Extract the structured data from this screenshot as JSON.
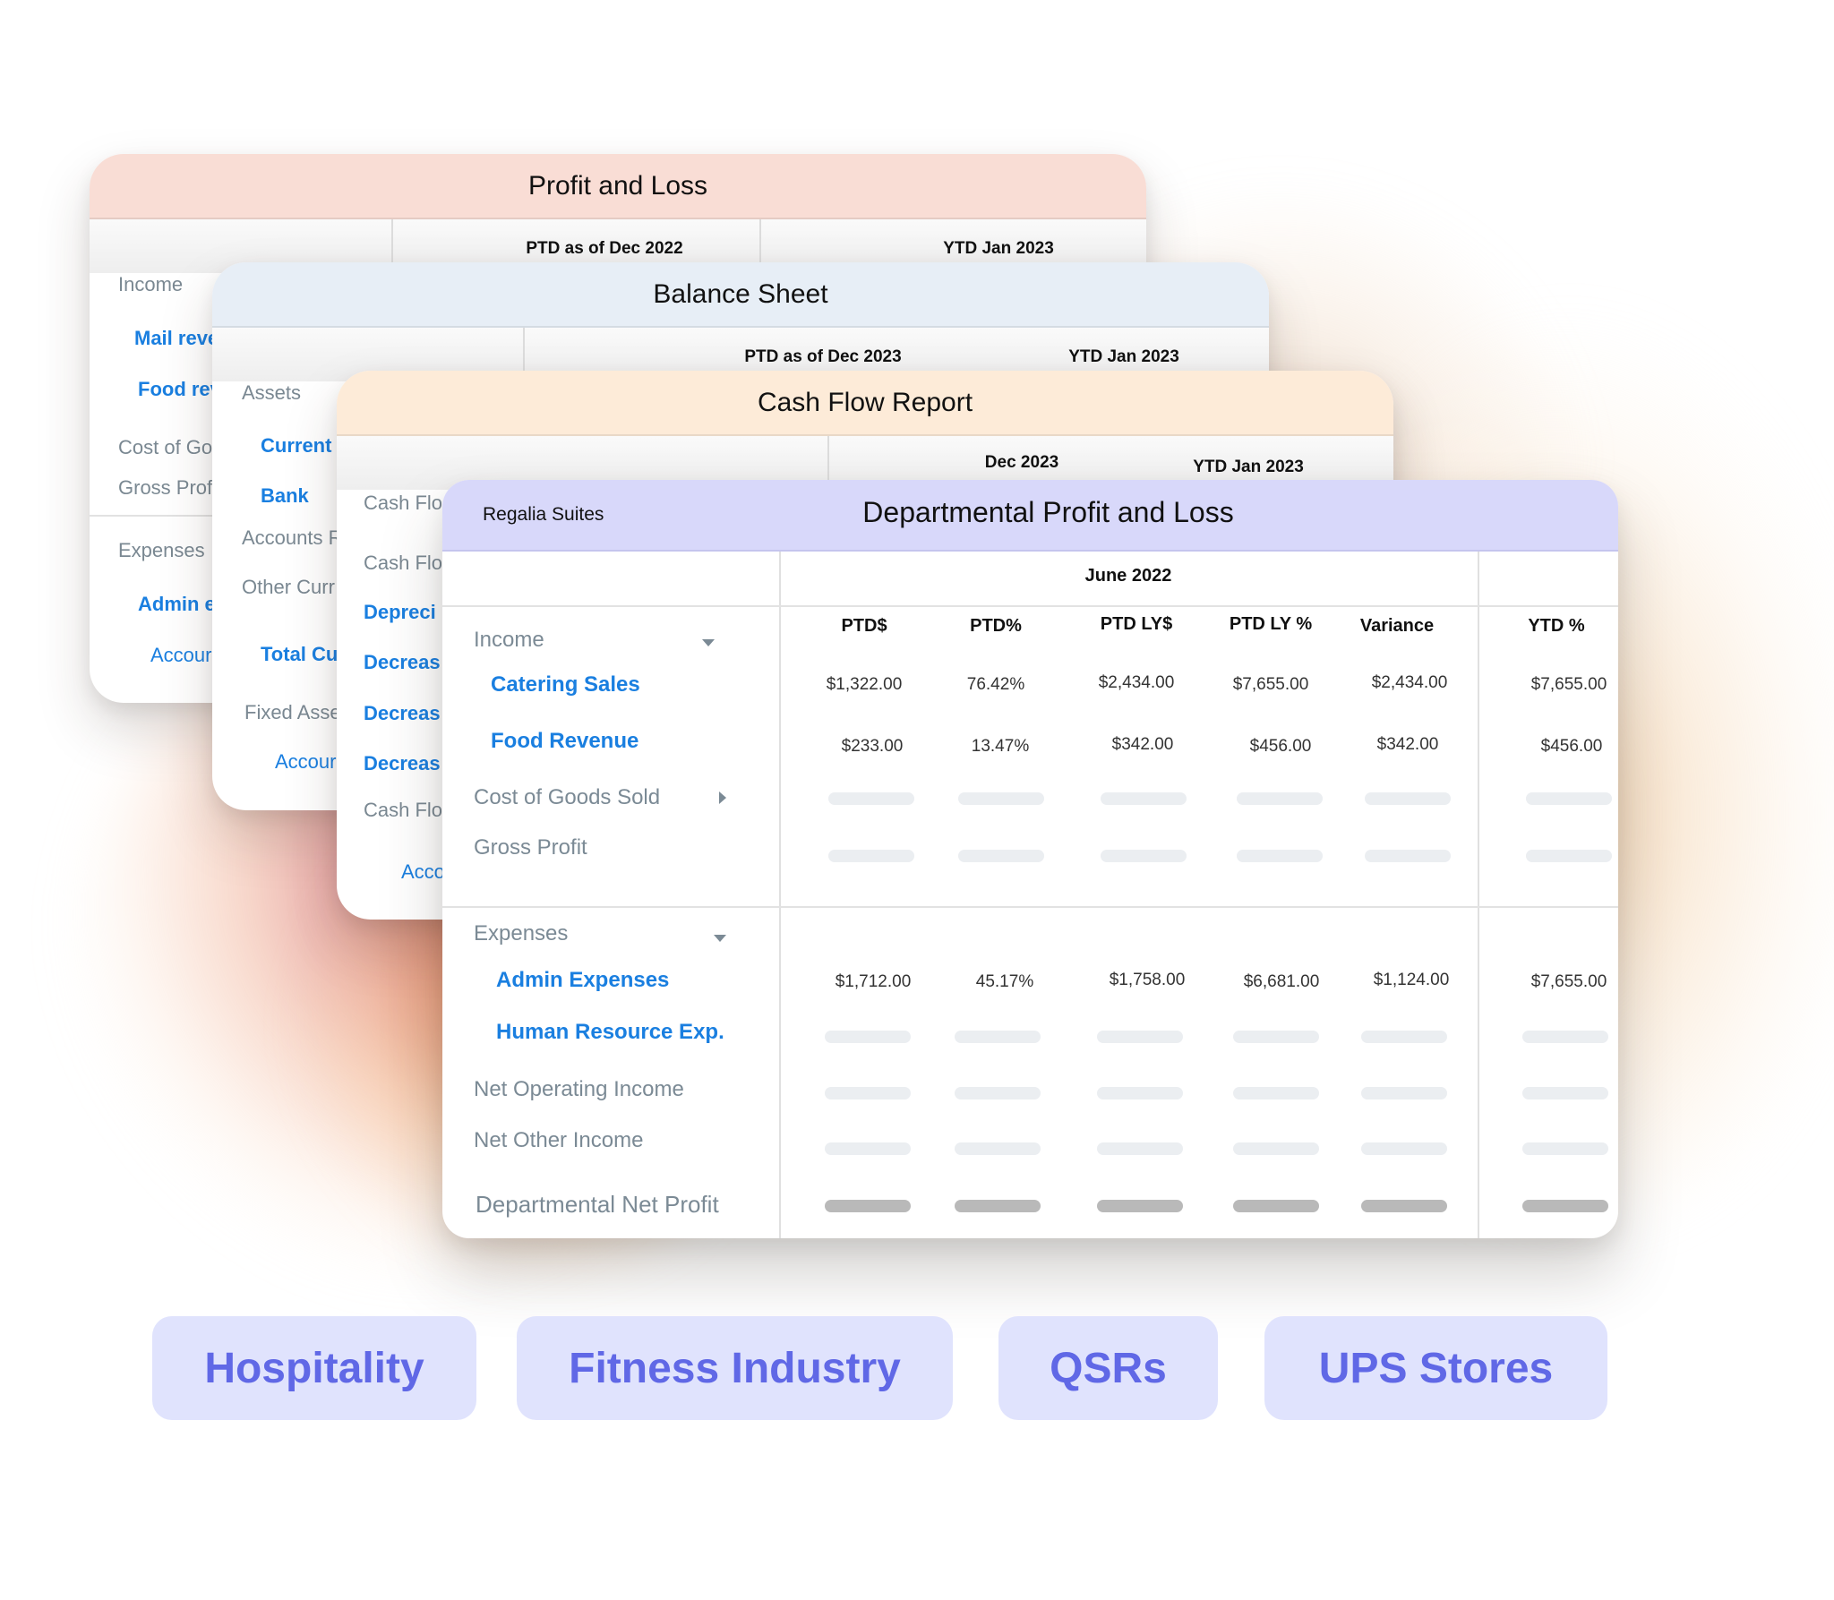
{
  "colors": {
    "profit_loss_header": "#f9ddd5",
    "balance_sheet_header": "#e7eef6",
    "cash_flow_header": "#fdebd8",
    "departmental_header": "#d8d8fa",
    "link_blue": "#1a7fe0",
    "label_grey": "#7b8a95",
    "industry_bg": "#e0e3fd",
    "industry_text": "#6068e6"
  },
  "profit_loss": {
    "title": "Profit and Loss",
    "columns": [
      "PTD as of Dec 2022",
      "YTD Jan 2023"
    ],
    "rows": [
      {
        "label": "Income",
        "style": "grey"
      },
      {
        "label": "Mail reve",
        "style": "blue"
      },
      {
        "label": "Food rev",
        "style": "blue"
      },
      {
        "label": "Cost of Go",
        "style": "grey"
      },
      {
        "label": "Gross Prof",
        "style": "grey"
      },
      {
        "label": "Expenses",
        "style": "grey"
      },
      {
        "label": "Admin e",
        "style": "blue"
      },
      {
        "label": "Accour",
        "style": "bluelite"
      }
    ]
  },
  "balance_sheet": {
    "title": "Balance Sheet",
    "columns": [
      "PTD as of Dec 2023",
      "YTD Jan 2023"
    ],
    "rows": [
      {
        "label": "Assets",
        "style": "grey"
      },
      {
        "label": "Current A",
        "style": "blue"
      },
      {
        "label": "Bank",
        "style": "blue"
      },
      {
        "label": "Accounts R",
        "style": "grey"
      },
      {
        "label": "Other Curr",
        "style": "grey"
      },
      {
        "label": "Total Cur",
        "style": "blue"
      },
      {
        "label": "Fixed Asse",
        "style": "grey"
      },
      {
        "label": "Accour",
        "style": "bluelite"
      }
    ]
  },
  "cash_flow": {
    "title": "Cash Flow Report",
    "columns": [
      "Dec 2023",
      "YTD Jan 2023"
    ],
    "rows": [
      {
        "label": "Cash Flo",
        "style": "grey"
      },
      {
        "label": "Cash Flo",
        "style": "grey"
      },
      {
        "label": "Depreci",
        "style": "blue"
      },
      {
        "label": "Decreas",
        "style": "blue"
      },
      {
        "label": "Decreas",
        "style": "blue"
      },
      {
        "label": "Decreas",
        "style": "blue"
      },
      {
        "label": "Cash Flo",
        "style": "grey"
      },
      {
        "label": "Acco",
        "style": "bluelite"
      }
    ]
  },
  "departmental": {
    "company": "Regalia Suites",
    "title": "Departmental Profit and Loss",
    "period": "June 2022",
    "columns": [
      "PTD$",
      "PTD%",
      "PTD LY$",
      "PTD LY %",
      "Variance",
      "YTD %"
    ],
    "rows": [
      {
        "label": "Income",
        "style": "grey",
        "toggle": "expanded"
      },
      {
        "label": "Catering Sales",
        "style": "blue",
        "values": [
          "$1,322.00",
          "76.42%",
          "$2,434.00",
          "$7,655.00",
          "$2,434.00",
          "$7,655.00"
        ]
      },
      {
        "label": "Food Revenue",
        "style": "blue",
        "values": [
          "$233.00",
          "13.47%",
          "$342.00",
          "$456.00",
          "$342.00",
          "$456.00"
        ]
      },
      {
        "label": "Cost of Goods Sold",
        "style": "grey",
        "toggle": "collapsed",
        "placeholder": true
      },
      {
        "label": "Gross Profit",
        "style": "grey",
        "placeholder": true
      },
      {
        "label": "Expenses",
        "style": "grey",
        "toggle": "expanded"
      },
      {
        "label": "Admin Expenses",
        "style": "blue",
        "values": [
          "$1,712.00",
          "45.17%",
          "$1,758.00",
          "$6,681.00",
          "$1,124.00",
          "$7,655.00"
        ]
      },
      {
        "label": "Human Resource Exp.",
        "style": "blue",
        "placeholder": true
      },
      {
        "label": "Net Operating Income",
        "style": "grey",
        "placeholder": true
      },
      {
        "label": "Net Other Income",
        "style": "grey",
        "placeholder": true
      },
      {
        "label": "Departmental Net Profit",
        "style": "grey",
        "placeholder": true,
        "placeholder_dark": true
      }
    ]
  },
  "industries": [
    "Hospitality",
    "Fitness Industry",
    "QSRs",
    "UPS Stores"
  ]
}
